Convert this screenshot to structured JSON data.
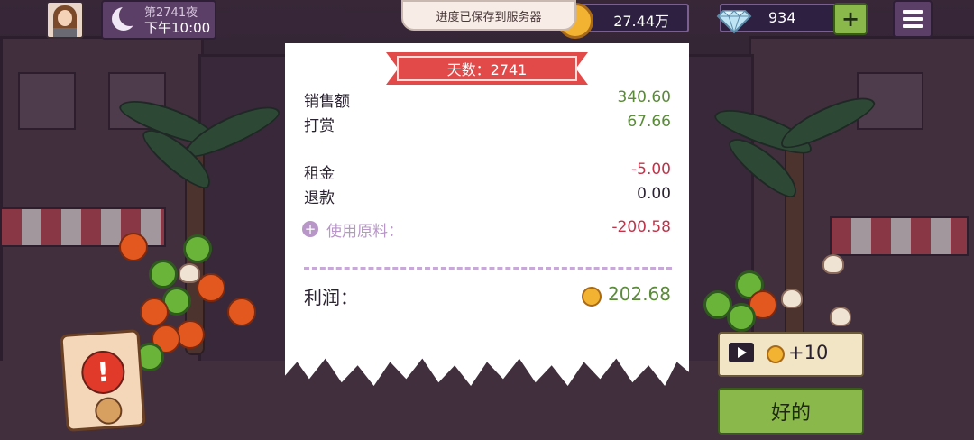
{
  "header": {
    "day_label": "第2741夜",
    "time_label": "下午10:00",
    "coins": "27.44万",
    "gems": "934",
    "add_gems": "+"
  },
  "toast": "进度已保存到服务器",
  "receipt": {
    "title": "天数：2741",
    "sales_label": "销售额",
    "sales_value": "340.60",
    "tips_label": "打赏",
    "tips_value": "67.66",
    "rent_label": "租金",
    "rent_value": "-5.00",
    "refund_label": "退款",
    "refund_value": "0.00",
    "materials_label": "使用原料：",
    "materials_plus": "+",
    "materials_value": "-200.58",
    "profit_label": "利润：",
    "profit_value": "202.68"
  },
  "actions": {
    "ad_reward": "+10",
    "ok_label": "好的",
    "alert_mark": "!"
  },
  "colors": {
    "positive": "#5a8a3a",
    "negative": "#c0344a",
    "ribbon": "#e24a4a",
    "ok_button": "#8ab84a"
  },
  "icons": [
    "avatar",
    "moon-icon",
    "coin-icon",
    "gem-icon",
    "plus-icon",
    "menu-icon",
    "play-icon",
    "alert-icon"
  ]
}
